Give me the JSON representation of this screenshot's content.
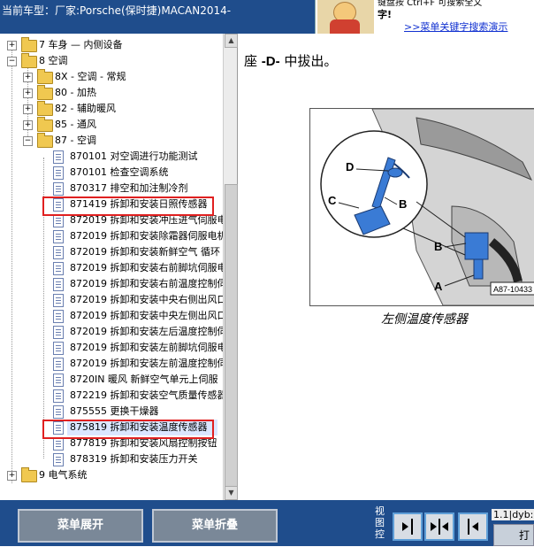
{
  "header": {
    "current_car": "当前车型：厂家:Porsche(保时捷)MACAN2014-",
    "ad_tip_line1": "键盘按 Ctrl+F 可搜索全文",
    "ad_tip_line2": "字!",
    "ad_link": ">>菜单关键字搜索演示"
  },
  "tree": {
    "items": [
      {
        "label": "7 车身 — 内侧设备"
      },
      {
        "label": "8 空调"
      },
      {
        "label": "8X - 空调 - 常规"
      },
      {
        "label": "80 - 加热"
      },
      {
        "label": "82 - 辅助暖风"
      },
      {
        "label": "85 - 通风"
      },
      {
        "label": "87 - 空调"
      },
      {
        "label": "870101 对空调进行功能测试"
      },
      {
        "label": "870101 检查空调系统"
      },
      {
        "label": "870317 排空和加注制冷剂"
      },
      {
        "label": "871419 拆卸和安装日照传感器"
      },
      {
        "label": "872019 拆卸和安装冲压进气伺服电"
      },
      {
        "label": "872019 拆卸和安装除霜器伺服电机"
      },
      {
        "label": "872019 拆卸和安装新鲜空气 循环"
      },
      {
        "label": "872019 拆卸和安装右前脚坑伺服电"
      },
      {
        "label": "872019 拆卸和安装右前温度控制伺"
      },
      {
        "label": "872019 拆卸和安装中央右侧出风口"
      },
      {
        "label": "872019 拆卸和安装中央左侧出风口"
      },
      {
        "label": "872019 拆卸和安装左后温度控制伺"
      },
      {
        "label": "872019 拆卸和安装左前脚坑伺服电"
      },
      {
        "label": "872019 拆卸和安装左前温度控制伺"
      },
      {
        "label": "8720IN 暖风 新鲜空气单元上伺服"
      },
      {
        "label": "872219 拆卸和安装空气质量传感器"
      },
      {
        "label": "875555 更换干燥器"
      },
      {
        "label": "875819 拆卸和安装温度传感器"
      },
      {
        "label": "877819 拆卸和安装风扇控制按钮"
      },
      {
        "label": "878319 拆卸和安装压力开关"
      },
      {
        "label": "9 电气系统"
      }
    ]
  },
  "content": {
    "text_prefix": "座 ",
    "text_bold": "-D-",
    "text_suffix": " 中拔出。",
    "figure": {
      "labels": {
        "a": "A",
        "b": "B",
        "c": "C",
        "d": "D",
        "b2": "B"
      },
      "code": "A87-10433"
    },
    "caption": "左侧温度传感器"
  },
  "footer": {
    "expand_label": "菜单展开",
    "collapse_label": "菜单折叠",
    "view_label": "视图控",
    "page_info": "1.1|dyb:",
    "extra_button": "打"
  }
}
